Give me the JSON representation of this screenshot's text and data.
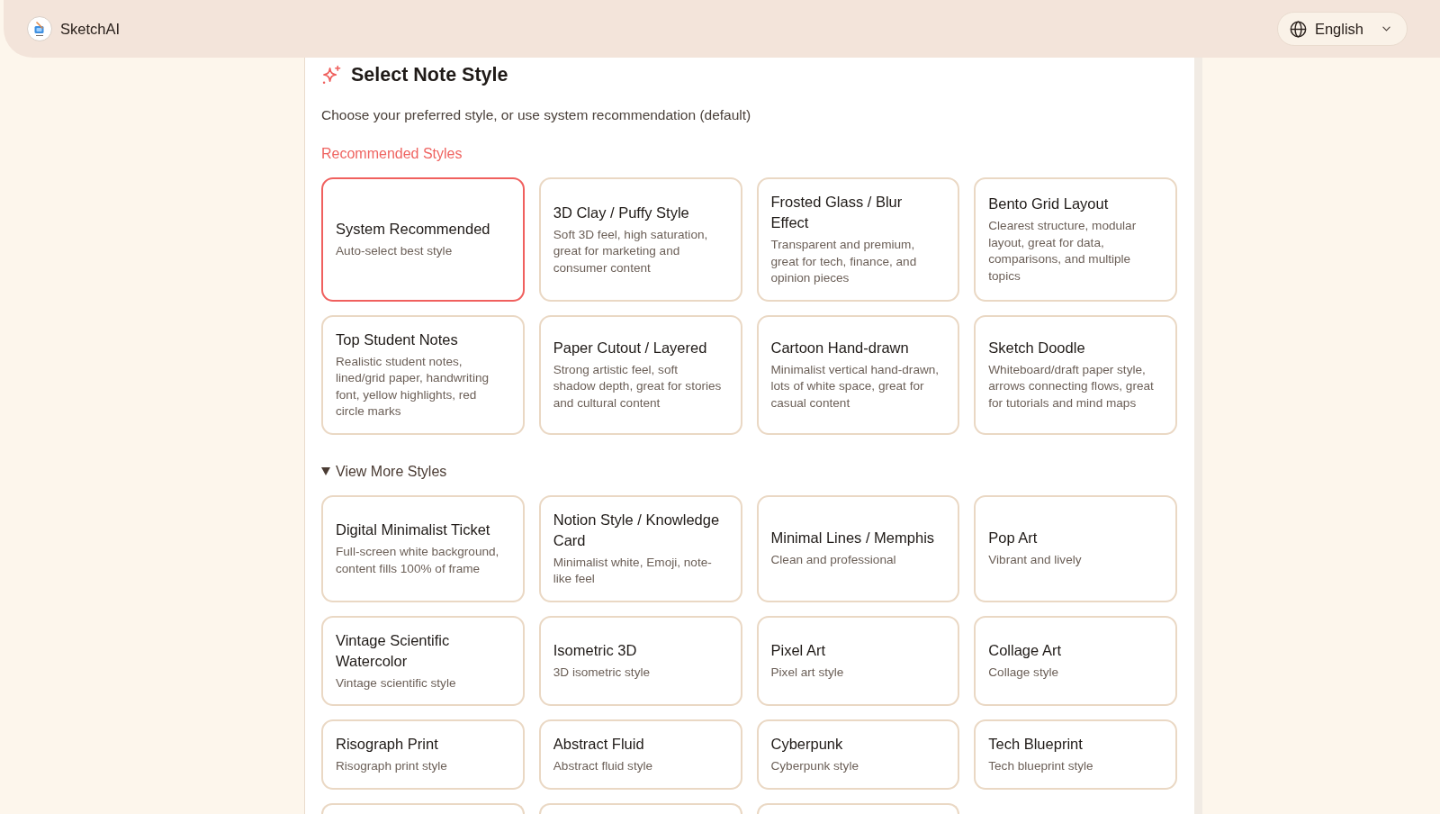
{
  "header": {
    "app_name": "SketchAI",
    "language": {
      "label": "English"
    }
  },
  "panel": {
    "title": "Select Note Style",
    "subtitle": "Choose your preferred style, or use system recommendation (default)"
  },
  "recommended": {
    "heading": "Recommended Styles",
    "styles": [
      {
        "title": "System Recommended",
        "description": "Auto-select best style",
        "selected": true
      },
      {
        "title": "3D Clay / Puffy Style",
        "description": "Soft 3D feel, high saturation, great for marketing and consumer content",
        "selected": false
      },
      {
        "title": "Frosted Glass / Blur Effect",
        "description": "Transparent and premium, great for tech, finance, and opinion pieces",
        "selected": false
      },
      {
        "title": "Bento Grid Layout",
        "description": "Clearest structure, modular layout, great for data, comparisons, and multiple topics",
        "selected": false
      },
      {
        "title": "Top Student Notes",
        "description": "Realistic student notes, lined/grid paper, handwriting font, yellow highlights, red circle marks",
        "selected": false
      },
      {
        "title": "Paper Cutout / Layered",
        "description": "Strong artistic feel, soft shadow depth, great for stories and cultural content",
        "selected": false
      },
      {
        "title": "Cartoon Hand-drawn",
        "description": "Minimalist vertical hand-drawn, lots of white space, great for casual content",
        "selected": false
      },
      {
        "title": "Sketch Doodle",
        "description": "Whiteboard/draft paper style, arrows connecting flows, great for tutorials and mind maps",
        "selected": false
      }
    ]
  },
  "more": {
    "toggle": {
      "label": "View More Styles",
      "expanded": true
    },
    "styles": [
      {
        "title": "Digital Minimalist Ticket",
        "description": "Full-screen white background, content fills 100% of frame",
        "selected": false
      },
      {
        "title": "Notion Style / Knowledge Card",
        "description": "Minimalist white, Emoji, note-like feel",
        "selected": false
      },
      {
        "title": "Minimal Lines / Memphis",
        "description": "Clean and professional",
        "selected": false
      },
      {
        "title": "Pop Art",
        "description": "Vibrant and lively",
        "selected": false
      },
      {
        "title": "Vintage Scientific Watercolor",
        "description": "Vintage scientific style",
        "selected": false
      },
      {
        "title": "Isometric 3D",
        "description": "3D isometric style",
        "selected": false
      },
      {
        "title": "Pixel Art",
        "description": "Pixel art style",
        "selected": false
      },
      {
        "title": "Collage Art",
        "description": "Collage style",
        "selected": false
      },
      {
        "title": "Risograph Print",
        "description": "Risograph print style",
        "selected": false
      },
      {
        "title": "Abstract Fluid",
        "description": "Abstract fluid style",
        "selected": false
      },
      {
        "title": "Cyberpunk",
        "description": "Cyberpunk style",
        "selected": false
      },
      {
        "title": "Tech Blueprint",
        "description": "Tech blueprint style",
        "selected": false
      }
    ]
  }
}
